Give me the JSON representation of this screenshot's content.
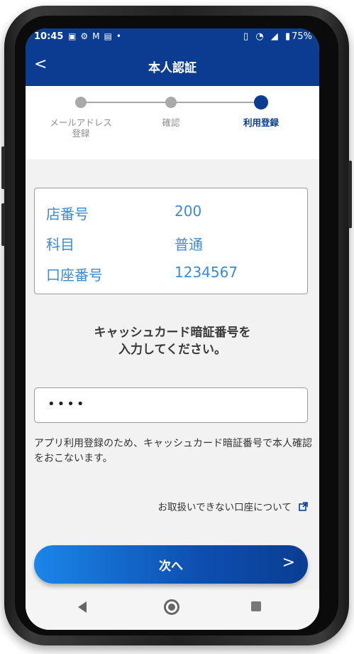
{
  "status_bar": {
    "time": "10:45",
    "left_icons": [
      "image-icon",
      "gear-icon",
      "mail-icon",
      "notes-icon",
      "dot-icon"
    ],
    "battery": "75%"
  },
  "header": {
    "back_label": "<",
    "title": "本人認証"
  },
  "stepper": {
    "steps": [
      {
        "label_line1": "メールアドレス",
        "label_line2": "登録"
      },
      {
        "label_line1": "確認",
        "label_line2": ""
      },
      {
        "label_line1": "利用登録",
        "label_line2": ""
      }
    ],
    "active_step": 3
  },
  "account": {
    "rows": [
      {
        "label": "店番号",
        "value": "200"
      },
      {
        "label": "科目",
        "value": "普通"
      },
      {
        "label": "口座番号",
        "value": "1234567"
      }
    ]
  },
  "instruction": {
    "line1": "キャッシュカード暗証番号を",
    "line2": "入力してください。"
  },
  "pin": {
    "value": "••••"
  },
  "note": "アプリ利用登録のため、キャッシュカード暗証番号で本人確認をおこないます。",
  "link": {
    "label": "お取扱いできない口座について"
  },
  "next_button": {
    "label": "次へ",
    "chevron": ">"
  },
  "colors": {
    "header": "#0a3d91",
    "accent_text": "#3d8ad1",
    "button_start": "#1a86e8",
    "button_end": "#0a3d91"
  }
}
